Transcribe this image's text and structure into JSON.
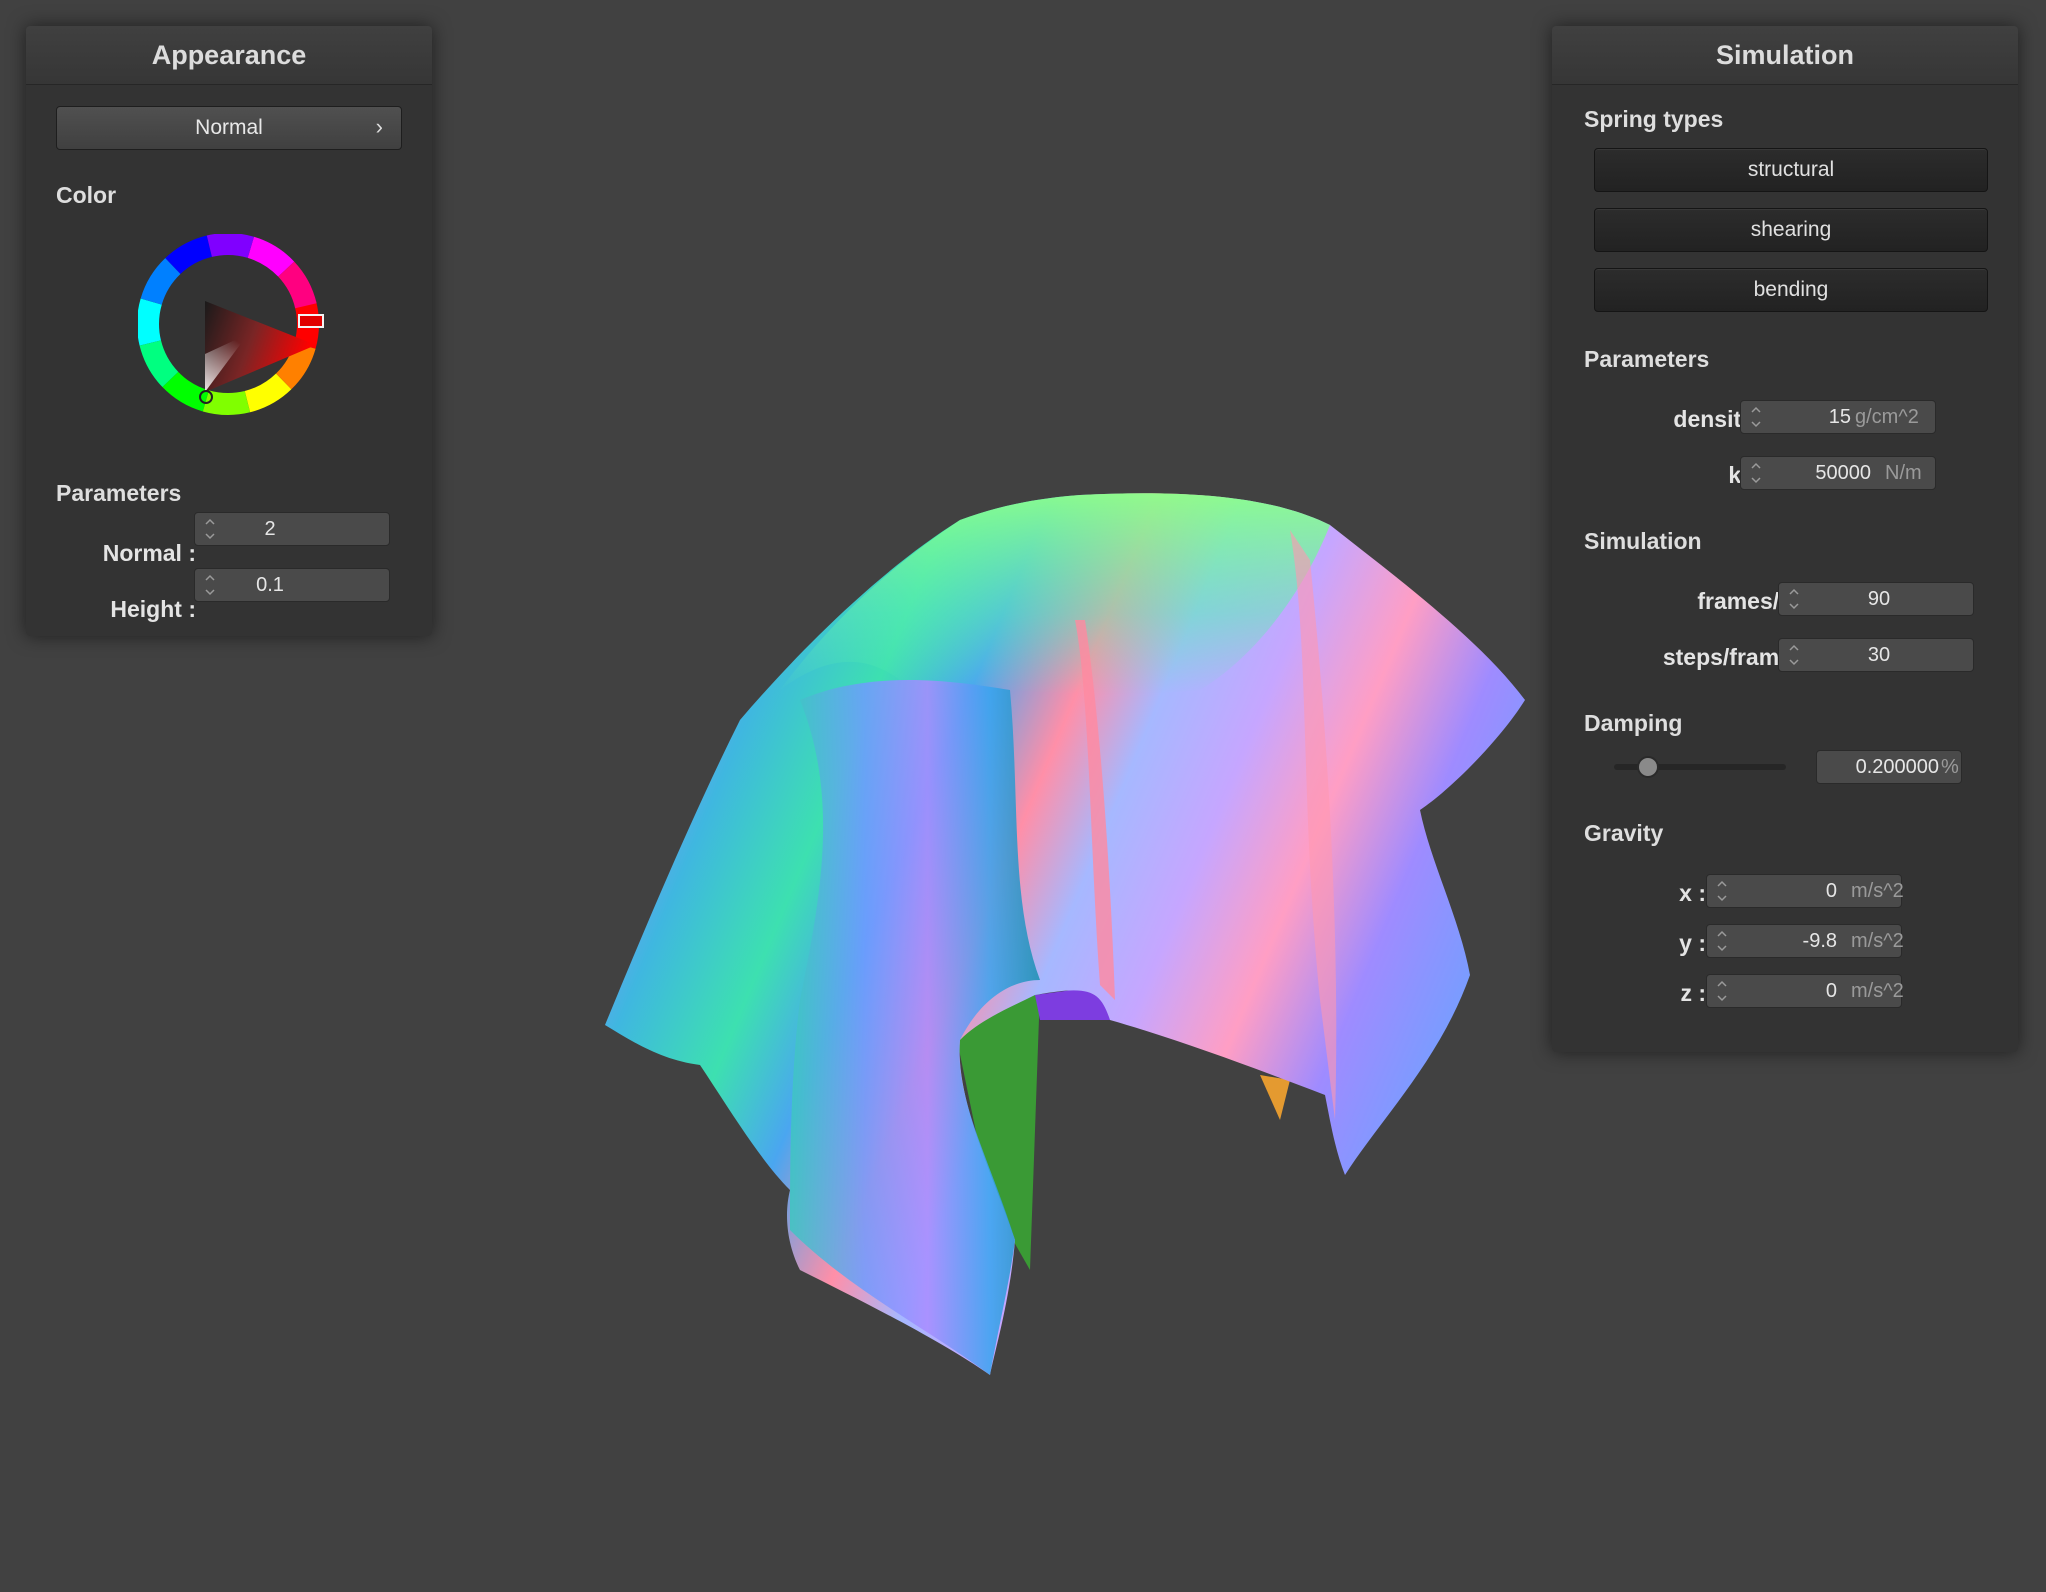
{
  "appearance": {
    "title": "Appearance",
    "shader_mode": "Normal",
    "color_label": "Color",
    "params_label": "Parameters",
    "normal": {
      "label": "Normal :",
      "value": "2"
    },
    "height": {
      "label": "Height :",
      "value": "0.1"
    }
  },
  "simulation": {
    "title": "Simulation",
    "spring_types_label": "Spring types",
    "springs": [
      "structural",
      "shearing",
      "bending"
    ],
    "params_label": "Parameters",
    "density": {
      "label": "density :",
      "value": "15",
      "unit": "g/cm^2"
    },
    "ks": {
      "label": "ks :",
      "value": "50000",
      "unit": "N/m"
    },
    "sim_label": "Simulation",
    "fps": {
      "label": "frames/s :",
      "value": "90"
    },
    "steps": {
      "label": "steps/frame :",
      "value": "30"
    },
    "damping_label": "Damping",
    "damping": {
      "value": "0.200000",
      "unit": "%",
      "fraction": 0.2
    },
    "gravity_label": "Gravity",
    "gx": {
      "label": "x :",
      "value": "0",
      "unit": "m/s^2"
    },
    "gy": {
      "label": "y :",
      "value": "-9.8",
      "unit": "m/s^2"
    },
    "gz": {
      "label": "z :",
      "value": "0",
      "unit": "m/s^2"
    }
  },
  "colors": {
    "background": "#414141",
    "panel": "#333333",
    "selected_color": "#e00000"
  }
}
